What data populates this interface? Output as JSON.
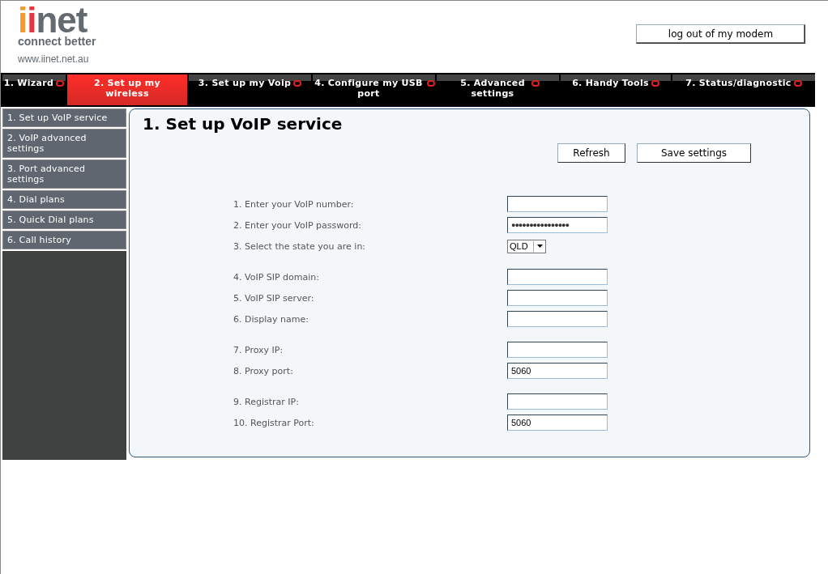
{
  "logo": {
    "parts": [
      {
        "text": "i",
        "color": "#f39a33"
      },
      {
        "text": "i",
        "color": "#e8343f"
      },
      {
        "text": "net",
        "color": "#636a70"
      }
    ],
    "tagline": "connect better",
    "url": "www.iinet.net.au"
  },
  "logout_button": "log out of my modem",
  "tabs": [
    {
      "label": "1. Wizard",
      "selected": false
    },
    {
      "label": "2. Set up my wireless",
      "selected": true
    },
    {
      "label": "3. Set up my Voip",
      "selected": false
    },
    {
      "label": "4. Configure my USB port",
      "selected": false
    },
    {
      "label": "5. Advanced settings",
      "selected": false
    },
    {
      "label": "6. Handy Tools",
      "selected": false
    },
    {
      "label": "7. Status/diagnostic",
      "selected": false
    }
  ],
  "sidebar": {
    "items": [
      "1. Set up VoIP service",
      "2. VoIP advanced settings",
      "3. Port advanced settings",
      "4. Dial plans",
      "5. Quick Dial plans",
      "6. Call history"
    ]
  },
  "content": {
    "title": "1. Set up VoIP service",
    "buttons": [
      "Refresh",
      "Save settings"
    ],
    "groups": [
      [
        {
          "label": "1. Enter your VoIP number:",
          "kind": "text"
        },
        {
          "label": "2. Enter your VoIP password:",
          "kind": "password",
          "value": "●●●●●●●●●●●●●●●●"
        },
        {
          "label": "3. Select the state you are in:",
          "kind": "select",
          "value": "QLD"
        }
      ],
      [
        {
          "label": "4. VoIP SIP domain:",
          "kind": "text"
        },
        {
          "label": "5. VoIP SIP server:",
          "kind": "text"
        },
        {
          "label": "6. Display name:",
          "kind": "text"
        }
      ],
      [
        {
          "label": "7. Proxy IP:",
          "kind": "text"
        },
        {
          "label": "8. Proxy port:",
          "kind": "text",
          "value": "5060"
        }
      ],
      [
        {
          "label": "9. Registrar IP:",
          "kind": "text"
        },
        {
          "label": "10. Registrar Port:",
          "kind": "text",
          "value": "5060"
        }
      ]
    ]
  }
}
